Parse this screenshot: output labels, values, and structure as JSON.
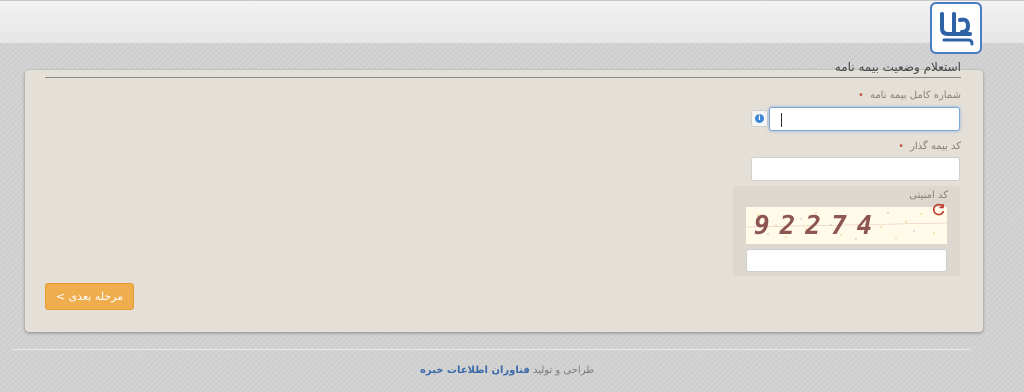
{
  "header": {
    "logo_alt": "حافظ"
  },
  "form": {
    "title": "استعلام وضعیت بیمه نامه",
    "policy_number": {
      "label": "شماره کامل بیمه نامه",
      "required_mark": "•",
      "value": "",
      "info_icon": "i"
    },
    "policyholder_code": {
      "label": "کد بیمه گذار",
      "required_mark": "•",
      "value": ""
    },
    "security": {
      "label": "کد امنیتی",
      "captcha_text": "92274",
      "value": ""
    },
    "next_button_label": "مرحله بعدی >"
  },
  "footer": {
    "prefix": "طراحی و تولید",
    "company": "فناوران اطلاعات خبره"
  },
  "colors": {
    "accent_button": "#f0ad4e",
    "focus_border": "#7aa6d6",
    "panel_bg": "#e4e0d8",
    "link": "#3a6aa8"
  }
}
